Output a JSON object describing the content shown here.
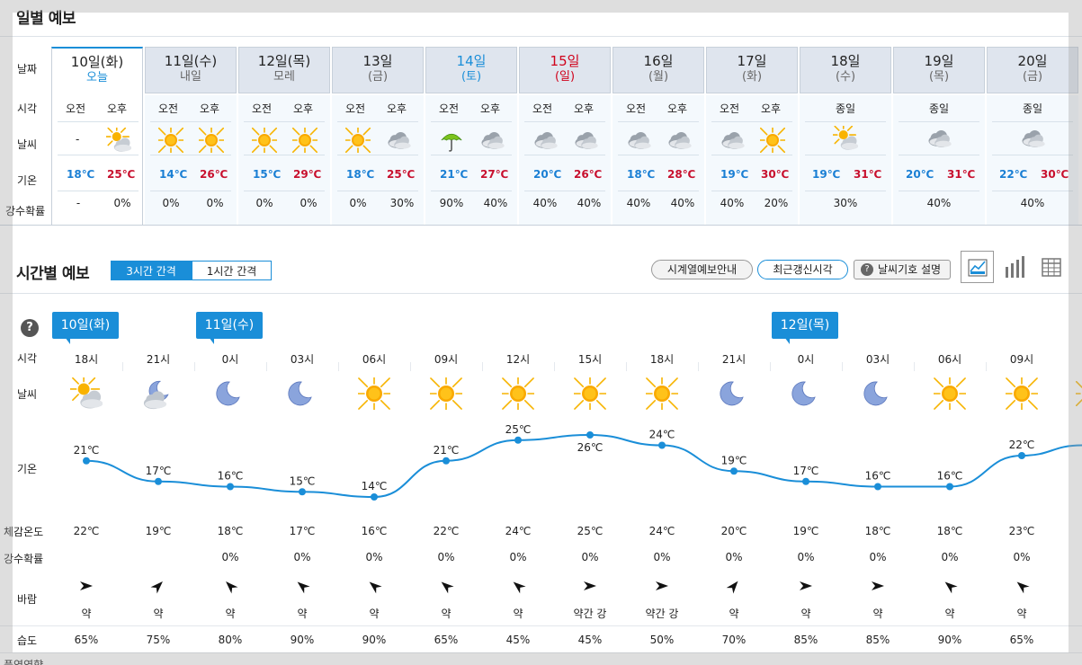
{
  "daily": {
    "title": "일별 예보",
    "row_labels": {
      "date": "날짜",
      "time": "시각",
      "weather": "날씨",
      "temp": "기온",
      "precip": "강수확률"
    },
    "days": [
      {
        "day": "10일(화)",
        "sub": "오늘",
        "kind": "today",
        "am_label": "오전",
        "pm_label": "오후",
        "am_icon": "none",
        "pm_icon": "partly-cloudy-icon",
        "am_weather": "-",
        "low": "18℃",
        "high": "25℃",
        "am_precip": "-",
        "pm_precip": "0%"
      },
      {
        "day": "11일(수)",
        "sub": "내일",
        "kind": "",
        "am_label": "오전",
        "pm_label": "오후",
        "am_icon": "sun-icon",
        "pm_icon": "sun-icon",
        "low": "14℃",
        "high": "26℃",
        "am_precip": "0%",
        "pm_precip": "0%"
      },
      {
        "day": "12일(목)",
        "sub": "모레",
        "kind": "",
        "am_label": "오전",
        "pm_label": "오후",
        "am_icon": "sun-icon",
        "pm_icon": "sun-icon",
        "low": "15℃",
        "high": "29℃",
        "am_precip": "0%",
        "pm_precip": "0%"
      },
      {
        "day": "13일",
        "sub": "(금)",
        "kind": "",
        "am_label": "오전",
        "pm_label": "오후",
        "am_icon": "sun-icon",
        "pm_icon": "cloudy-icon",
        "low": "18℃",
        "high": "25℃",
        "am_precip": "0%",
        "pm_precip": "30%"
      },
      {
        "day": "14일",
        "sub": "(토)",
        "kind": "sat",
        "am_label": "오전",
        "pm_label": "오후",
        "am_icon": "umbrella-icon",
        "pm_icon": "cloudy-icon",
        "low": "21℃",
        "high": "27℃",
        "am_precip": "90%",
        "pm_precip": "40%"
      },
      {
        "day": "15일",
        "sub": "(일)",
        "kind": "sun",
        "am_label": "오전",
        "pm_label": "오후",
        "am_icon": "cloudy-icon",
        "pm_icon": "cloudy-icon",
        "low": "20℃",
        "high": "26℃",
        "am_precip": "40%",
        "pm_precip": "40%"
      },
      {
        "day": "16일",
        "sub": "(월)",
        "kind": "",
        "am_label": "오전",
        "pm_label": "오후",
        "am_icon": "cloudy-icon",
        "pm_icon": "cloudy-icon",
        "low": "18℃",
        "high": "28℃",
        "am_precip": "40%",
        "pm_precip": "40%"
      },
      {
        "day": "17일",
        "sub": "(화)",
        "kind": "",
        "am_label": "오전",
        "pm_label": "오후",
        "am_icon": "cloudy-icon",
        "pm_icon": "sun-icon",
        "low": "19℃",
        "high": "30℃",
        "am_precip": "40%",
        "pm_precip": "20%"
      },
      {
        "day": "18일",
        "sub": "(수)",
        "kind": "allday",
        "all_label": "종일",
        "all_icon": "partly-cloudy-icon",
        "low": "19℃",
        "high": "31℃",
        "all_precip": "30%"
      },
      {
        "day": "19일",
        "sub": "(목)",
        "kind": "allday",
        "all_label": "종일",
        "all_icon": "cloudy-icon",
        "low": "20℃",
        "high": "31℃",
        "all_precip": "40%"
      },
      {
        "day": "20일",
        "sub": "(금)",
        "kind": "allday",
        "all_label": "종일",
        "all_icon": "cloudy-icon",
        "low": "22℃",
        "high": "30℃",
        "all_precip": "40%"
      }
    ]
  },
  "hourly": {
    "title": "시간별 예보",
    "interval_tabs": [
      "3시간 간격",
      "1시간 간격"
    ],
    "buttons": {
      "timeseries": "시계열예보안내",
      "updated": "최근갱신시각",
      "symbols": "날씨기호 설명"
    },
    "help_glyph": "?",
    "row_labels": {
      "time": "시각",
      "weather": "날씨",
      "temp": "기온",
      "feels": "체감온도",
      "precip": "강수확률",
      "wind": "바람",
      "humidity": "습도",
      "cutoff": "풍역영향"
    },
    "date_badges": [
      {
        "label": "10일(화)",
        "col": 0
      },
      {
        "label": "11일(수)",
        "col": 2
      },
      {
        "label": "12일(목)",
        "col": 10
      }
    ],
    "hours": [
      {
        "time": "18시",
        "icon": "partly-cloudy-icon",
        "temp": 21,
        "temp_label": "21℃",
        "feels": "22℃",
        "precip": "",
        "wind_dir": 0,
        "wind": "약",
        "humidity": "65%"
      },
      {
        "time": "21시",
        "icon": "night-cloudy-icon",
        "temp": 17,
        "temp_label": "17℃",
        "feels": "19℃",
        "precip": "",
        "wind_dir": -45,
        "wind": "약",
        "humidity": "75%"
      },
      {
        "time": "0시",
        "icon": "moon-icon",
        "temp": 16,
        "temp_label": "16℃",
        "feels": "18℃",
        "precip": "0%",
        "wind_dir": -135,
        "wind": "약",
        "humidity": "80%"
      },
      {
        "time": "03시",
        "icon": "moon-icon",
        "temp": 15,
        "temp_label": "15℃",
        "feels": "17℃",
        "precip": "0%",
        "wind_dir": -140,
        "wind": "약",
        "humidity": "90%"
      },
      {
        "time": "06시",
        "icon": "sun-icon",
        "temp": 14,
        "temp_label": "14℃",
        "feels": "16℃",
        "precip": "0%",
        "wind_dir": -140,
        "wind": "약",
        "humidity": "90%"
      },
      {
        "time": "09시",
        "icon": "sun-icon",
        "temp": 21,
        "temp_label": "21℃",
        "feels": "22℃",
        "precip": "0%",
        "wind_dir": -140,
        "wind": "약",
        "humidity": "65%"
      },
      {
        "time": "12시",
        "icon": "sun-icon",
        "temp": 25,
        "temp_label": "25℃",
        "feels": "24℃",
        "precip": "0%",
        "wind_dir": -140,
        "wind": "약",
        "humidity": "45%"
      },
      {
        "time": "15시",
        "icon": "sun-icon",
        "temp": 26,
        "temp_label": "26℃",
        "feels": "25℃",
        "precip": "0%",
        "wind_dir": 0,
        "wind": "약간 강",
        "humidity": "45%"
      },
      {
        "time": "18시",
        "icon": "sun-icon",
        "temp": 24,
        "temp_label": "24℃",
        "feels": "24℃",
        "precip": "0%",
        "wind_dir": 0,
        "wind": "약간 강",
        "humidity": "50%"
      },
      {
        "time": "21시",
        "icon": "moon-icon",
        "temp": 19,
        "temp_label": "19℃",
        "feels": "20℃",
        "precip": "0%",
        "wind_dir": -50,
        "wind": "약",
        "humidity": "70%"
      },
      {
        "time": "0시",
        "icon": "moon-icon",
        "temp": 17,
        "temp_label": "17℃",
        "feels": "19℃",
        "precip": "0%",
        "wind_dir": 0,
        "wind": "약",
        "humidity": "85%"
      },
      {
        "time": "03시",
        "icon": "moon-icon",
        "temp": 16,
        "temp_label": "16℃",
        "feels": "18℃",
        "precip": "0%",
        "wind_dir": 0,
        "wind": "약",
        "humidity": "85%"
      },
      {
        "time": "06시",
        "icon": "sun-icon",
        "temp": 16,
        "temp_label": "16℃",
        "feels": "18℃",
        "precip": "0%",
        "wind_dir": -140,
        "wind": "약",
        "humidity": "90%"
      },
      {
        "time": "09시",
        "icon": "sun-icon",
        "temp": 22,
        "temp_label": "22℃",
        "feels": "23℃",
        "precip": "0%",
        "wind_dir": -140,
        "wind": "약",
        "humidity": "65%"
      }
    ]
  },
  "colors": {
    "accent": "#1a8ed8",
    "low": "#1a7fd4",
    "high": "#c8102e",
    "sun": "#f5a800",
    "moon": "#6a86c8",
    "cloud": "#a9b0b8"
  }
}
